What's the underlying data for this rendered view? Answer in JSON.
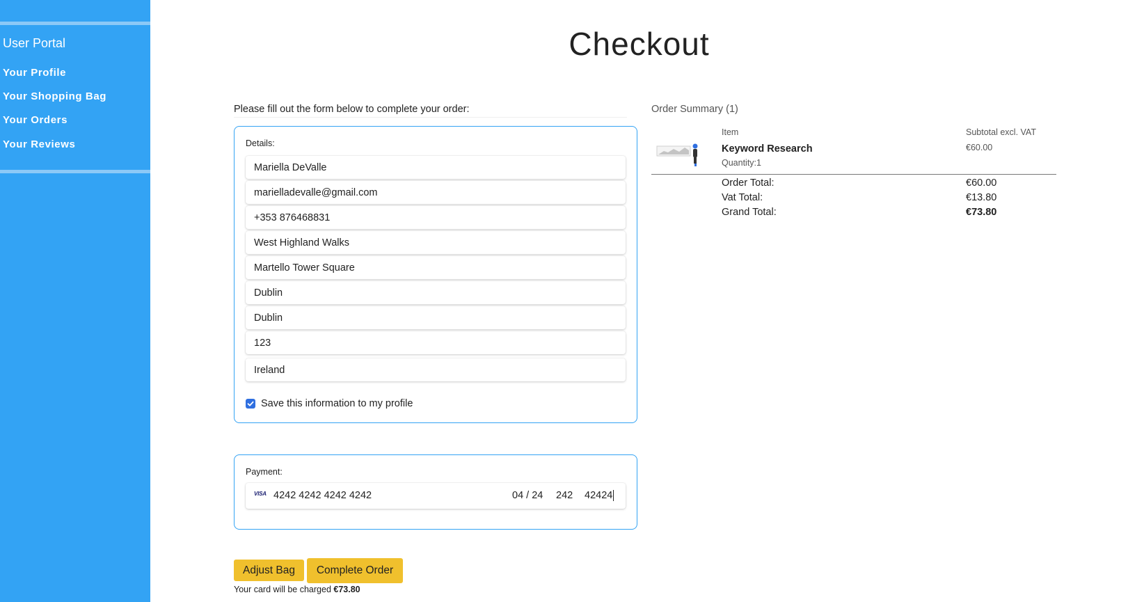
{
  "sidebar": {
    "title": "User Portal",
    "items": [
      {
        "label": "Your Profile"
      },
      {
        "label": "Your Shopping Bag"
      },
      {
        "label": "Your Orders"
      },
      {
        "label": "Your Reviews"
      }
    ]
  },
  "page": {
    "title": "Checkout",
    "intro": "Please fill out the form below to complete your order:"
  },
  "details": {
    "legend": "Details:",
    "fields": {
      "full_name": "Mariella DeValle",
      "email": "marielladevalle@gmail.com",
      "phone": "+353 876468831",
      "street1": "West Highland Walks",
      "street2": "Martello Tower Square",
      "town": "Dublin",
      "county": "Dublin",
      "postcode": "123",
      "country": "Ireland"
    },
    "save_checkbox_label": "Save this information to my profile",
    "save_checked": true
  },
  "payment": {
    "legend": "Payment:",
    "card_brand": "VISA",
    "card_number": "4242 4242 4242 4242",
    "expiry": "04 / 24",
    "cvc": "242",
    "postal": "42424"
  },
  "actions": {
    "adjust_label": "Adjust Bag",
    "complete_label": "Complete Order",
    "charge_prefix": "Your card will be charged",
    "charge_amount": "€73.80"
  },
  "summary": {
    "title": "Order Summary (1)",
    "col_item": "Item",
    "col_subtotal": "Subtotal excl. VAT",
    "product": {
      "name": "Keyword Research",
      "quantity": "Quantity:1",
      "price": "€60.00"
    },
    "totals": {
      "order_label": "Order Total:",
      "order_value": "€60.00",
      "vat_label": "Vat Total:",
      "vat_value": "€13.80",
      "grand_label": "Grand Total:",
      "grand_value": "€73.80"
    }
  },
  "colors": {
    "sidebar": "#33a3f4",
    "accent_border": "#33a3f4",
    "button": "#f0c02d",
    "checkbox": "#2f6fe0"
  }
}
